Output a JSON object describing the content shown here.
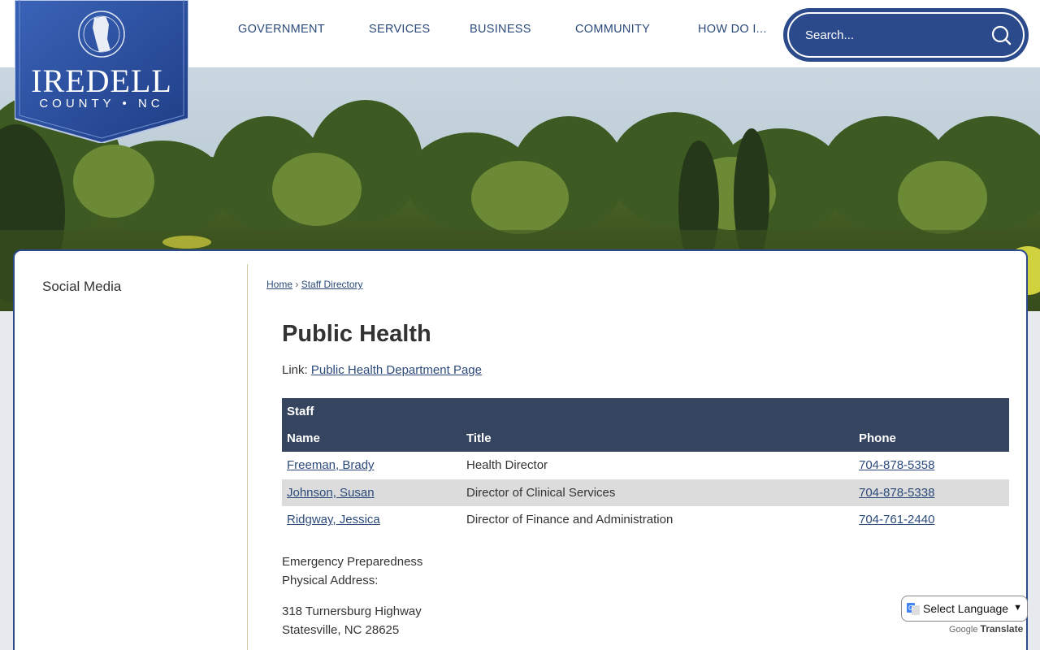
{
  "logo": {
    "title": "IREDELL",
    "subtitle": "COUNTY • NC"
  },
  "nav": {
    "items": [
      {
        "label": "GOVERNMENT"
      },
      {
        "label": "SERVICES"
      },
      {
        "label": "BUSINESS"
      },
      {
        "label": "COMMUNITY"
      },
      {
        "label": "HOW DO I..."
      }
    ]
  },
  "search": {
    "placeholder": "Search..."
  },
  "sidebar": {
    "items": [
      {
        "label": "Social Media"
      }
    ]
  },
  "breadcrumb": {
    "home": "Home",
    "separator": "›",
    "current": "Staff Directory"
  },
  "page": {
    "title": "Public Health",
    "link_prefix": "Link:",
    "link_text": "Public Health Department Page"
  },
  "staff_table": {
    "caption": "Staff",
    "columns": [
      "Name",
      "Title",
      "Phone"
    ],
    "rows": [
      {
        "name": "Freeman, Brady",
        "title": "Health Director",
        "phone": "704-878-5358"
      },
      {
        "name": "Johnson, Susan",
        "title": "Director of Clinical Services",
        "phone": "704-878-5338"
      },
      {
        "name": "Ridgway, Jessica",
        "title": "Director of Finance and Administration",
        "phone": "704-761-2440"
      }
    ]
  },
  "address": {
    "line1": "Emergency Preparedness",
    "line2": "Physical Address:",
    "street": "318 Turnersburg Highway",
    "city": "Statesville, NC 28625"
  },
  "translate": {
    "label": "Select Language",
    "powered_by": "Google",
    "brand": "Translate"
  },
  "colors": {
    "brand_blue": "#2a4a8c",
    "table_header": "#35445f",
    "link": "#2b4a7a",
    "row_alt": "#dcdcdc"
  }
}
